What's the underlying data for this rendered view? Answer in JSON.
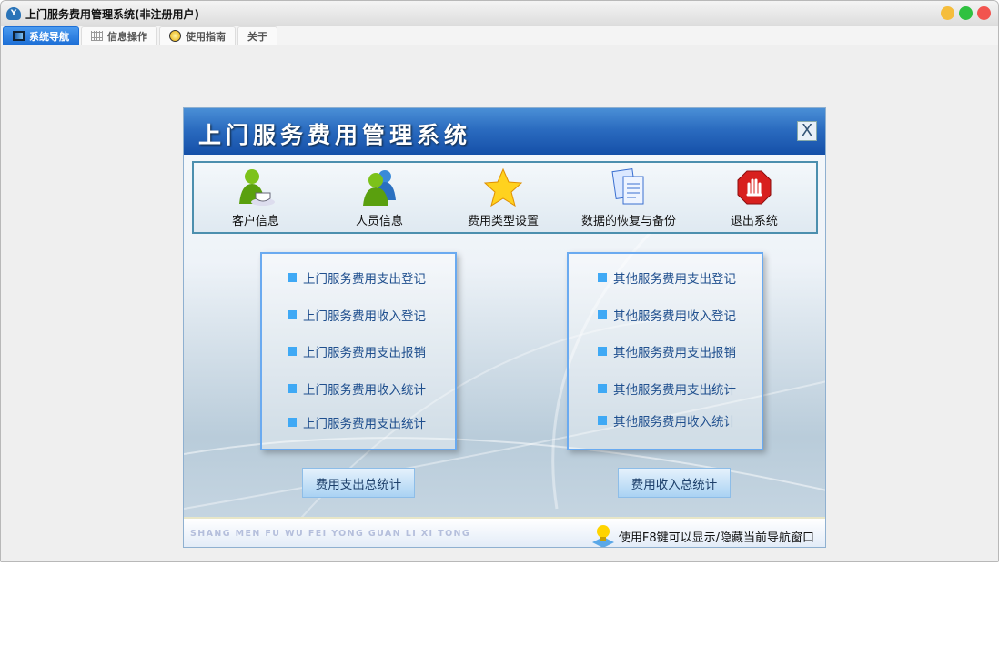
{
  "window": {
    "title": "上门服务费用管理系统(非注册用户)",
    "app_icon": "cloud-logo-icon"
  },
  "tabs": [
    {
      "label": "系统导航",
      "icon": "monitor-icon"
    },
    {
      "label": "信息操作",
      "icon": "grid-icon"
    },
    {
      "label": "使用指南",
      "icon": "help-bulb-icon"
    },
    {
      "label": "关于"
    }
  ],
  "panel": {
    "title": "上门服务费用管理系统",
    "close_label": "X",
    "toolbar": [
      {
        "label": "客户信息",
        "icon": "user-coffee-icon"
      },
      {
        "label": "人员信息",
        "icon": "users-icon"
      },
      {
        "label": "费用类型设置",
        "icon": "star-icon"
      },
      {
        "label": "数据的恢复与备份",
        "icon": "documents-icon"
      },
      {
        "label": "退出系统",
        "icon": "stop-hand-icon"
      }
    ],
    "left_list": [
      "上门服务费用支出登记",
      "上门服务费用收入登记",
      "上门服务费用支出报销",
      "上门服务费用收入统计",
      "上门服务费用支出统计"
    ],
    "right_list": [
      "其他服务费用支出登记",
      "其他服务费用收入登记",
      "其他服务费用支出报销",
      "其他服务费用支出统计",
      "其他服务费用收入统计"
    ],
    "left_button": "费用支出总统计",
    "right_button": "费用收入总统计",
    "footer_pinyin": "SHANG MEN FU WU FEI YONG GUAN LI XI TONG",
    "footer_hint": "使用F8键可以显示/隐藏当前导航窗口"
  },
  "colors": {
    "accent": "#1d6fd6",
    "link": "#1f4f8e",
    "bullet": "#3fa9f5"
  }
}
